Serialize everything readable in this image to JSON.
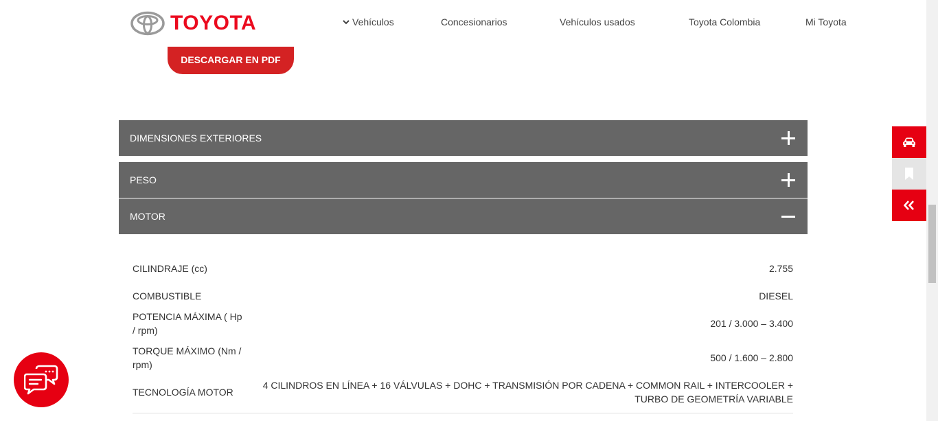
{
  "brand": {
    "name": "TOYOTA",
    "color": "#eb0a1e"
  },
  "nav": {
    "items": [
      {
        "label": "Vehículos",
        "has_chevron": true
      },
      {
        "label": "Concesionarios"
      },
      {
        "label": "Vehículos usados"
      },
      {
        "label": "Toyota Colombia"
      },
      {
        "label": "Mi Toyota"
      }
    ]
  },
  "pdf_button": {
    "label": "DESCARGAR EN PDF"
  },
  "accordion": [
    {
      "label": "DIMENSIONES EXTERIORES",
      "state": "collapsed"
    },
    {
      "label": "PESO",
      "state": "collapsed"
    },
    {
      "label": "MOTOR",
      "state": "expanded"
    }
  ],
  "motor_specs": [
    {
      "label": "CILINDRAJE (cc)",
      "value": "2.755"
    },
    {
      "label": "COMBUSTIBLE",
      "value": "DIESEL"
    },
    {
      "label": "POTENCIA MÁXIMA ( Hp / rpm)",
      "value": "201 / 3.000 – 3.400"
    },
    {
      "label": "TORQUE MÁXIMO (Nm / rpm)",
      "value": "500 / 1.600 – 2.800"
    },
    {
      "label": "TECNOLOGÍA MOTOR",
      "value": "4 CILINDROS EN LÍNEA + 16 VÁLVULAS + DOHC + TRANSMISIÓN POR CADENA + COMMON RAIL + INTERCOOLER + TURBO DE GEOMETRÍA VARIABLE"
    }
  ],
  "side_bar": [
    {
      "icon": "car-icon"
    },
    {
      "icon": "bookmark-icon"
    },
    {
      "icon": "double-chevron-left-icon"
    }
  ],
  "chat": {
    "icon": "chat-bubbles-icon"
  },
  "colors": {
    "accent_red": "#e60012",
    "accordion_gray": "#666666"
  }
}
